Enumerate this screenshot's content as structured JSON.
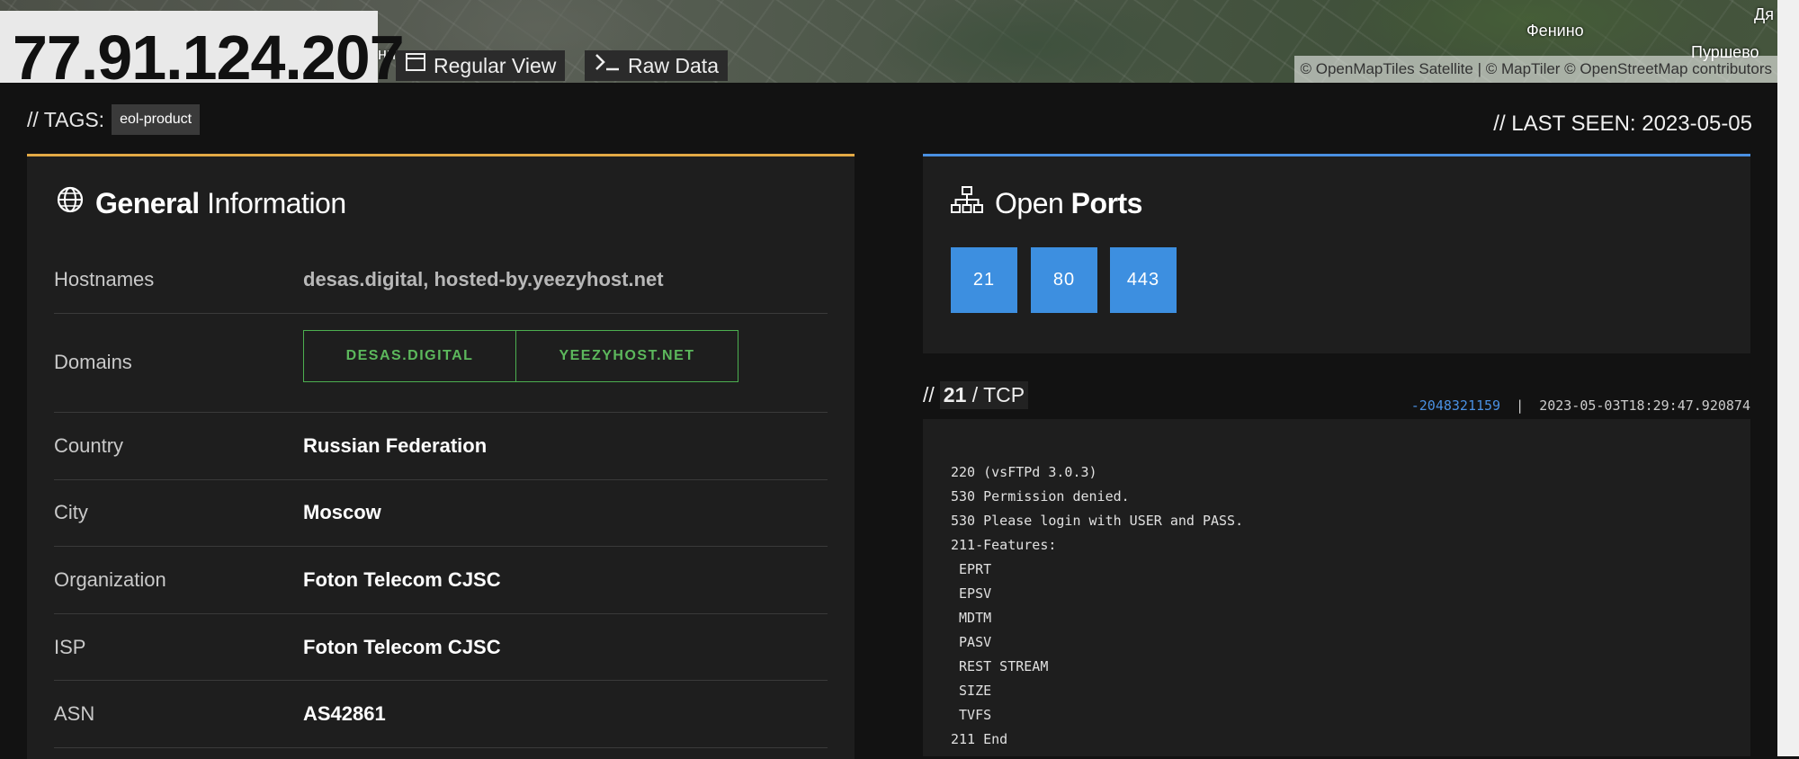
{
  "map": {
    "labels": [
      {
        "id": "fenino",
        "text": "Фенино"
      },
      {
        "id": "purshevo",
        "text": "Пуршево"
      },
      {
        "id": "dya",
        "text": "Дя"
      },
      {
        "id": "ni",
        "text": "ни"
      }
    ],
    "attribution": "© OpenMapTiles Satellite | © MapTiler © OpenStreetMap contributors"
  },
  "header": {
    "ip": "77.91.124.207",
    "regular_view": "Regular View",
    "raw_data": "Raw Data"
  },
  "tags": {
    "prefix": "// TAGS:",
    "items": [
      "eol-product"
    ]
  },
  "last_seen": "// LAST SEEN: 2023-05-05",
  "general": {
    "title_bold": "General",
    "title_rest": "Information",
    "rows": [
      {
        "key": "Hostnames",
        "value": "desas.digital, hosted-by.yeezyhost.net"
      },
      {
        "key": "Domains",
        "domains": [
          "DESAS.DIGITAL",
          "YEEZYHOST.NET"
        ]
      },
      {
        "key": "Country",
        "value": "Russian Federation"
      },
      {
        "key": "City",
        "value": "Moscow"
      },
      {
        "key": "Organization",
        "value": "Foton Telecom CJSC"
      },
      {
        "key": "ISP",
        "value": "Foton Telecom CJSC"
      },
      {
        "key": "ASN",
        "value": "AS42861"
      }
    ]
  },
  "ports": {
    "title_rest": "Open",
    "title_bold": "Ports",
    "items": [
      "21",
      "80",
      "443"
    ]
  },
  "service": {
    "prefix": "//",
    "port": "21",
    "proto": "/ TCP",
    "hash": "-2048321159",
    "separator": "|",
    "timestamp": "2023-05-03T18:29:47.920874",
    "banner": "220 (vsFTPd 3.0.3)\n530 Permission denied.\n530 Please login with USER and PASS.\n211-Features:\n EPRT\n EPSV\n MDTM\n PASV\n REST STREAM\n SIZE\n TVFS\n211 End"
  },
  "colors": {
    "accent_general": "#e3a945",
    "accent_ports": "#4a90e2",
    "domain_green": "#5cb85c"
  }
}
